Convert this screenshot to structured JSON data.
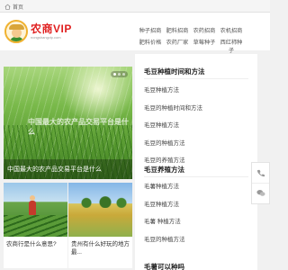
{
  "topbar": {
    "home_label": "首页"
  },
  "logo": {
    "title": "农商VIP",
    "subtitle": "nongshangvip.com"
  },
  "nav": {
    "row1": [
      "种子招商",
      "肥料招商",
      "农药招商",
      "农机招商"
    ],
    "row2": [
      "肥料价格",
      "农药厂家",
      "草莓种子",
      "西红柿种子"
    ]
  },
  "banner": {
    "caption": "中国最大的农产品交易平台是什么",
    "watermark": "中国最大的农产品交易平台是什么",
    "dots": 3,
    "active_dot": 0
  },
  "cards": [
    {
      "title": "农商行是什么意思?"
    },
    {
      "title": "贵州有什么好玩的地方最..."
    }
  ],
  "sections": [
    {
      "title": "毛豆种植时间和方法",
      "items": [
        "毛豆种植方法",
        "毛豆的种植时间和方法",
        "毛豆种植方法",
        "毛豆的种植方法",
        "毛豆的养殖方法"
      ]
    },
    {
      "title": "毛豆养殖方法",
      "items": [
        "毛薯种植方法",
        "毛豆种植方法",
        "毛薯 种植方法",
        "毛豆的种植方法"
      ]
    },
    {
      "title": "毛薯可以种吗",
      "items": []
    }
  ],
  "colors": {
    "accent": "#e02020",
    "logo_ring": "#f0b230",
    "text": "#333333"
  },
  "icons": {
    "home": "home-icon",
    "phone": "phone-icon",
    "wechat": "wechat-icon"
  }
}
